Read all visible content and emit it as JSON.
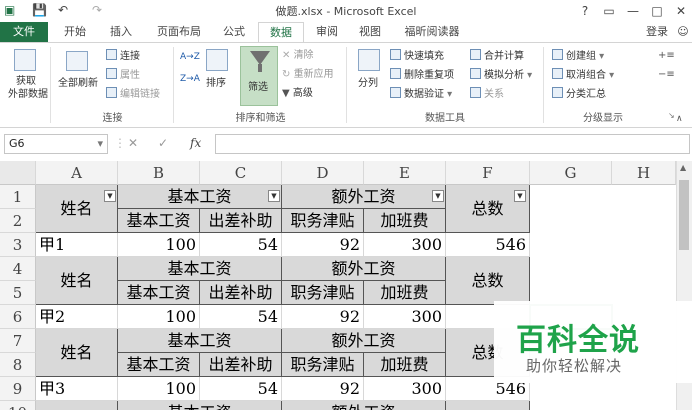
{
  "window": {
    "title": "做题.xlsx - Microsoft Excel",
    "help": "?",
    "restore_icon": "restore-icon",
    "minimize": "—",
    "maximize": "□",
    "close": "✕"
  },
  "quick_access": {
    "save": "💾",
    "undo": "↶",
    "redo": "↷"
  },
  "tabs": [
    "文件",
    "开始",
    "插入",
    "页面布局",
    "公式",
    "数据",
    "审阅",
    "视图",
    "福昕阅读器"
  ],
  "active_tab": "数据",
  "account": "登录",
  "ribbon": {
    "get_external": [
      "获取",
      "外部数据"
    ],
    "refresh_all": [
      "全部刷新"
    ],
    "connections": "连接",
    "properties": "属性",
    "edit_links": "编辑链接",
    "group_connections": "连接",
    "sort_asc": "A→Z",
    "sort_desc": "Z→A",
    "sort": "排序",
    "filter": "筛选",
    "clear": "清除",
    "reapply": "重新应用",
    "advanced": "高级",
    "group_sort_filter": "排序和筛选",
    "text_to_columns": "分列",
    "flash_fill": "快速填充",
    "remove_duplicates": "删除重复项",
    "data_validation": "数据验证",
    "consolidate": "合并计算",
    "what_if": "模拟分析",
    "relationships": "关系",
    "group_data_tools": "数据工具",
    "group_create": "创建组",
    "ungroup": "取消组合",
    "subtotal": "分类汇总",
    "group_outline": "分级显示"
  },
  "formula_bar": {
    "name_box": "G6",
    "cancel": "✕",
    "enter": "✓",
    "fx": "fx",
    "formula": ""
  },
  "columns": [
    "A",
    "B",
    "C",
    "D",
    "E",
    "F",
    "G",
    "H"
  ],
  "rows": [
    "1",
    "2",
    "3",
    "4",
    "5",
    "6",
    "7",
    "8",
    "9",
    "10"
  ],
  "header": {
    "name": "姓名",
    "base_group": "基本工资",
    "extra_group": "额外工资",
    "base_pay": "基本工资",
    "travel": "出差补助",
    "post": "职务津贴",
    "overtime": "加班费",
    "total": "总数"
  },
  "records": [
    {
      "name": "甲1",
      "base": "100",
      "travel": "54",
      "post": "92",
      "overtime": "300",
      "total": "546"
    },
    {
      "name": "甲2",
      "base": "100",
      "travel": "54",
      "post": "92",
      "overtime": "300",
      "total": ""
    },
    {
      "name": "甲3",
      "base": "100",
      "travel": "54",
      "post": "92",
      "overtime": "300",
      "total": "546"
    }
  ],
  "partial_header": {
    "base_group": "基本工资",
    "extra_group": "额外工资"
  },
  "watermark": {
    "line1": "百科全说",
    "line2": "助你轻松解决"
  }
}
